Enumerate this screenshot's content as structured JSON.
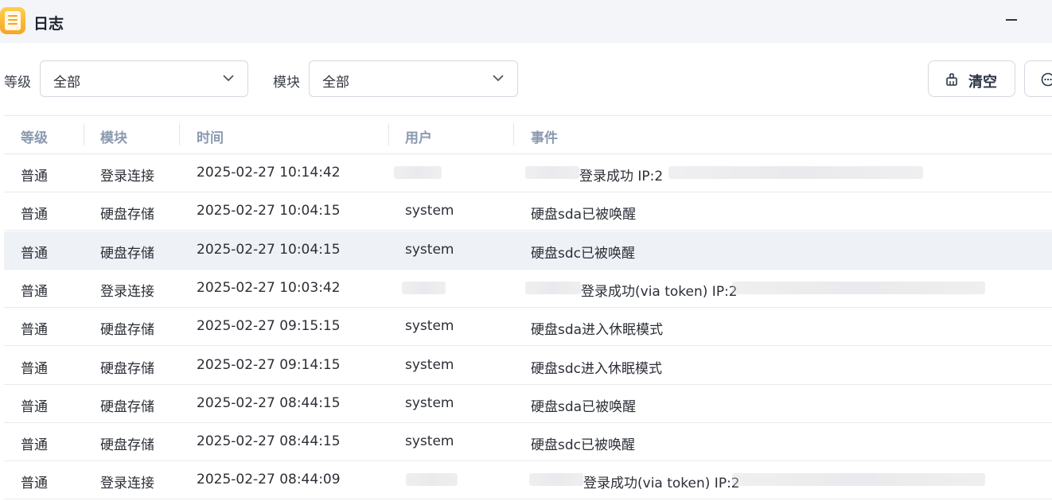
{
  "window": {
    "title": "日志",
    "app_icon": "log-app-icon",
    "minimize_icon": "minimize-icon"
  },
  "filters": {
    "level_label": "等级",
    "level_value": "全部",
    "module_label": "模块",
    "module_value": "全部"
  },
  "toolbar": {
    "clear_label": "清空",
    "clear_icon": "broom-icon",
    "more_icon": "more-icon"
  },
  "table": {
    "headers": [
      "等级",
      "模块",
      "时间",
      "用户",
      "事件"
    ],
    "rows": [
      {
        "level": "普通",
        "module": "登录连接",
        "time": "2025-02-27 10:14:42",
        "user": "",
        "event": "登录成功 IP:2"
      },
      {
        "level": "普通",
        "module": "硬盘存储",
        "time": "2025-02-27 10:04:15",
        "user": "system",
        "event": "硬盘sda已被唤醒"
      },
      {
        "level": "普通",
        "module": "硬盘存储",
        "time": "2025-02-27 10:04:15",
        "user": "system",
        "event": "硬盘sdc已被唤醒"
      },
      {
        "level": "普通",
        "module": "登录连接",
        "time": "2025-02-27 10:03:42",
        "user": "",
        "event": "登录成功(via token) IP:2"
      },
      {
        "level": "普通",
        "module": "硬盘存储",
        "time": "2025-02-27 09:15:15",
        "user": "system",
        "event": "硬盘sda进入休眠模式"
      },
      {
        "level": "普通",
        "module": "硬盘存储",
        "time": "2025-02-27 09:14:15",
        "user": "system",
        "event": "硬盘sdc进入休眠模式"
      },
      {
        "level": "普通",
        "module": "硬盘存储",
        "time": "2025-02-27 08:44:15",
        "user": "system",
        "event": "硬盘sda已被唤醒"
      },
      {
        "level": "普通",
        "module": "硬盘存储",
        "time": "2025-02-27 08:44:15",
        "user": "system",
        "event": "硬盘sdc已被唤醒"
      },
      {
        "level": "普通",
        "module": "登录连接",
        "time": "2025-02-27 08:44:09",
        "user": "",
        "event": "登录成功(via token) IP:2"
      }
    ]
  },
  "colors": {
    "titlebar_bg": "#f3f5f9",
    "header_text": "#8a99b0",
    "highlight_row": "#eef1f6",
    "app_icon_accent": "#f5a623"
  }
}
